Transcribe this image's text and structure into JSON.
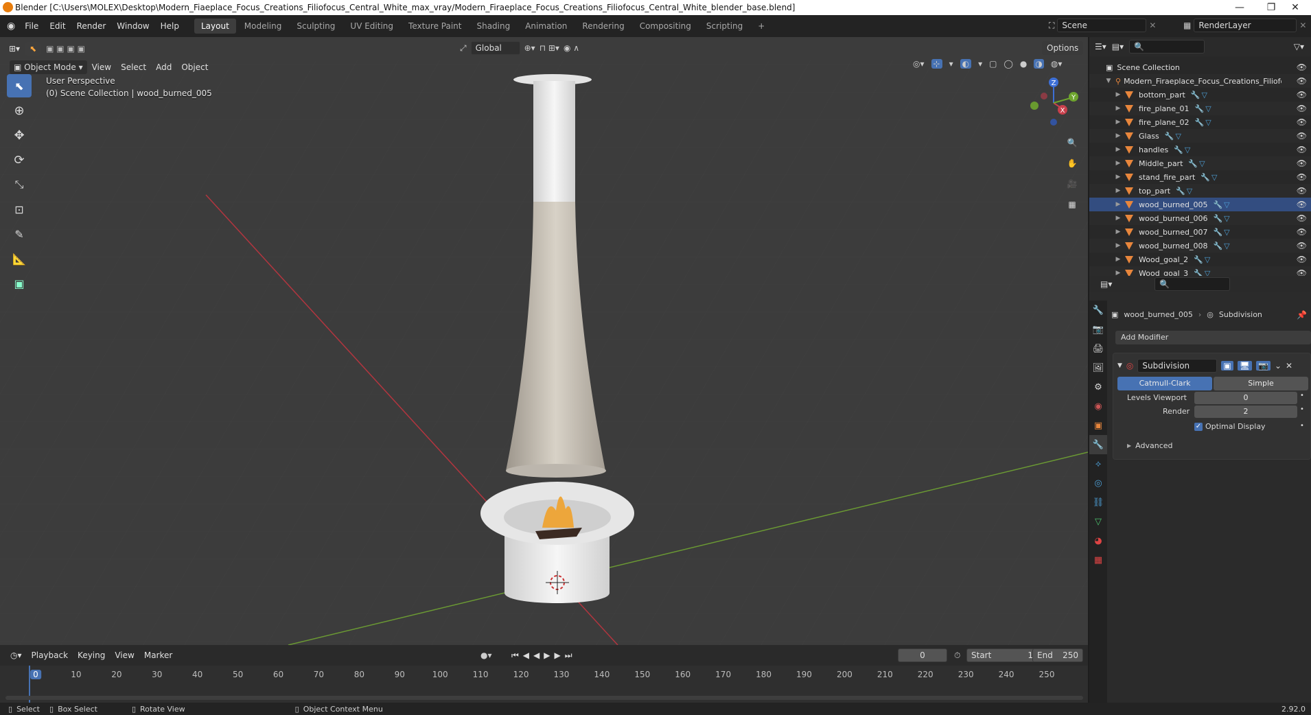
{
  "window": {
    "title": "Blender [C:\\Users\\MOLEX\\Desktop\\Modern_Fiaeplace_Focus_Creations_Filiofocus_Central_White_max_vray/Modern_Firaeplace_Focus_Creations_Filiofocus_Central_White_blender_base.blend]",
    "minimize": "—",
    "restore": "❐",
    "close": "✕"
  },
  "menu": [
    "File",
    "Edit",
    "Render",
    "Window",
    "Help"
  ],
  "workspaces": [
    "Layout",
    "Modeling",
    "Sculpting",
    "UV Editing",
    "Texture Paint",
    "Shading",
    "Animation",
    "Rendering",
    "Compositing",
    "Scripting"
  ],
  "active_workspace": "Layout",
  "scene": {
    "name": "Scene",
    "render_layer": "RenderLayer"
  },
  "viewport": {
    "mode": "Object Mode",
    "header_menu": [
      "View",
      "Select",
      "Add",
      "Object"
    ],
    "transform_orientation": "Global",
    "options_label": "Options",
    "perspective_label": "User Perspective",
    "collection_label": "(0) Scene Collection | wood_burned_005",
    "gizmo_axes": {
      "x": "X",
      "y": "Y",
      "z": "Z"
    }
  },
  "outliner": {
    "root": "Scene Collection",
    "collection": "Modern_Firaeplace_Focus_Creations_Filiofoc",
    "objects": [
      "bottom_part",
      "fire_plane_01",
      "fire_plane_02",
      "Glass",
      "handles",
      "Middle_part",
      "stand_fire_part",
      "top_part",
      "wood_burned_005",
      "wood_burned_006",
      "wood_burned_007",
      "wood_burned_008",
      "Wood_goal_2",
      "Wood_goal_3"
    ],
    "selected": "wood_burned_005"
  },
  "properties": {
    "object_name": "wood_burned_005",
    "modifier_breadcrumb": "Subdivision",
    "add_modifier": "Add Modifier",
    "modifier": {
      "name": "Subdivision",
      "types": [
        "Catmull-Clark",
        "Simple"
      ],
      "active_type": "Catmull-Clark",
      "levels_viewport_label": "Levels Viewport",
      "levels_viewport": "0",
      "render_label": "Render",
      "render": "2",
      "optimal_display_label": "Optimal Display",
      "optimal_display": true,
      "advanced_label": "Advanced"
    }
  },
  "timeline": {
    "menu": [
      "Playback",
      "Keying",
      "View",
      "Marker"
    ],
    "current_frame": "0",
    "start_label": "Start",
    "start": "1",
    "end_label": "End",
    "end": "250",
    "ticks": [
      "0",
      "10",
      "20",
      "30",
      "40",
      "50",
      "60",
      "70",
      "80",
      "90",
      "100",
      "110",
      "120",
      "130",
      "140",
      "150",
      "160",
      "170",
      "180",
      "190",
      "200",
      "210",
      "220",
      "230",
      "240",
      "250"
    ]
  },
  "status": {
    "select": "Select",
    "box_select": "Box Select",
    "rotate_view": "Rotate View",
    "context_menu": "Object Context Menu",
    "version": "2.92.0"
  }
}
